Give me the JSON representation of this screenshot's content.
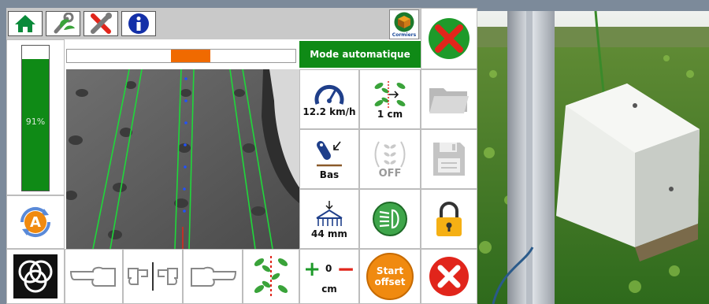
{
  "header": {
    "icons": [
      "home-icon",
      "wrench-leaf-icon",
      "tools-icon",
      "info-icon"
    ],
    "logo_text": "Cormiers"
  },
  "mode": {
    "label": "Mode automatique"
  },
  "level_gauge": {
    "label": "91%",
    "value_percent": 91
  },
  "position_bar": {
    "marker_fraction": 0.35
  },
  "auto_button": {
    "letter": "A"
  },
  "tiles": {
    "speed": {
      "value": "12.2 km/h",
      "icon": "speedometer-icon"
    },
    "offset": {
      "value": "1 cm",
      "icon": "row-offset-icon"
    },
    "lift": {
      "value": "Bas",
      "icon": "hitch-lift-icon"
    },
    "weeding": {
      "value": "OFF",
      "icon": "weeding-mode-icon"
    },
    "depth": {
      "value": "44 mm",
      "icon": "harrow-depth-icon"
    },
    "lights": {
      "icon": "headlight-icon"
    },
    "folder": {
      "icon": "folder-icon"
    },
    "save": {
      "icon": "save-icon"
    },
    "lock": {
      "icon": "lock-icon"
    }
  },
  "offset_control": {
    "plus": "+",
    "value": "0",
    "minus": "−",
    "unit": "cm"
  },
  "start_offset": {
    "line1": "Start",
    "line2": "offset"
  },
  "colors": {
    "green": "#0f8a16",
    "orange": "#f06a00",
    "red": "#e1251b"
  }
}
